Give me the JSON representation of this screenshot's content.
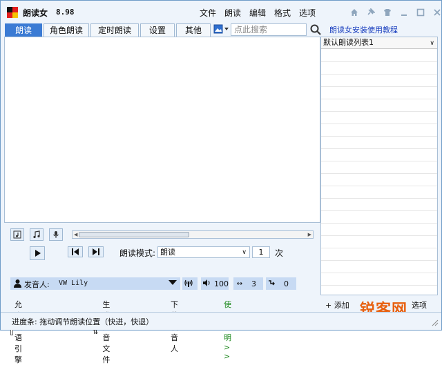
{
  "app": {
    "name": "朗读女",
    "version": "8.98"
  },
  "menu": [
    "文件",
    "朗读",
    "编辑",
    "格式",
    "选项"
  ],
  "window_icons": [
    "home-icon",
    "pin-icon",
    "shirt-icon",
    "minimize-icon",
    "maximize-icon",
    "close-icon"
  ],
  "tabs": [
    {
      "label": "朗读",
      "active": true
    },
    {
      "label": "角色朗读",
      "active": false
    },
    {
      "label": "定时朗读",
      "active": false
    },
    {
      "label": "设置",
      "active": false
    },
    {
      "label": "其他",
      "active": false
    }
  ],
  "search": {
    "placeholder": "点此搜索"
  },
  "help_link": "朗读女安装使用教程",
  "playlist": {
    "selected": "默认朗读列表1"
  },
  "controls": {
    "mode_label": "朗读模式:",
    "mode_value": "朗读",
    "times_value": "1",
    "times_unit": "次",
    "voice_label": "发音人:",
    "voice_value": "VW Lily",
    "volume": "100",
    "speed": "3",
    "pitch": "0",
    "allow_bilingual": "允许双语引擎",
    "generate_audio": "生成声音文件",
    "download_voice": "下载发音人",
    "usage_link": "使用说明 > >"
  },
  "playlist_footer": {
    "add_label": "添加",
    "options_label": "选项"
  },
  "status": {
    "text": "进度条: 拖动调节朗读位置（快进，快退）"
  },
  "watermark": "锐客网",
  "colors": {
    "tab_active": "#3b7bd4",
    "link_blue": "#1a3fbf",
    "link_green": "#1f8a1f",
    "watermark": "#e8600f",
    "panel_bg": "#eef4fb",
    "pill_bg": "#c7daf3"
  }
}
